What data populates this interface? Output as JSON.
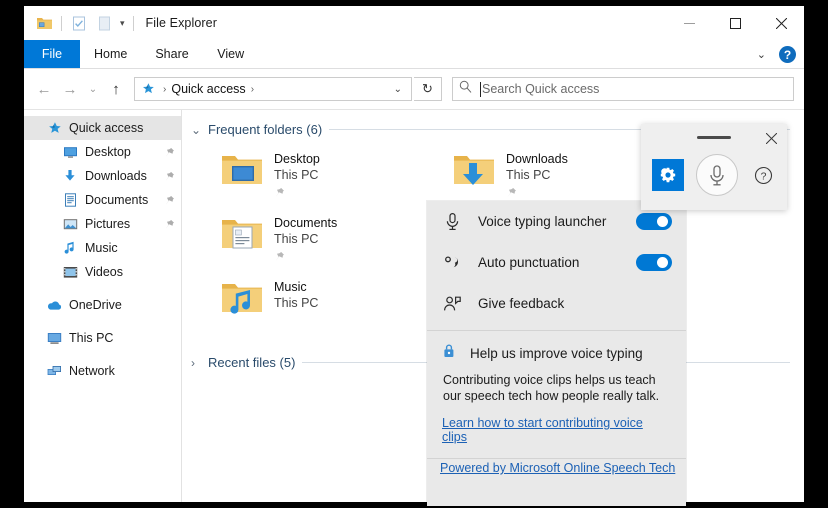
{
  "window": {
    "title": "File Explorer",
    "quick_access_icons": [
      "folder-icon",
      "properties-icon",
      "new-folder-icon"
    ],
    "qat_caret": "customize-quick-access-toolbar",
    "controls": {
      "minimize": "minimize-icon",
      "maximize": "maximize-icon",
      "close": "close-icon"
    }
  },
  "ribbon": {
    "tabs": [
      {
        "label": "File",
        "active": true
      },
      {
        "label": "Home",
        "active": false
      },
      {
        "label": "Share",
        "active": false
      },
      {
        "label": "View",
        "active": false
      }
    ],
    "expand_caret": "chevron-down-icon",
    "help_label": "?"
  },
  "addressbar": {
    "back": "back-arrow-icon",
    "forward": "forward-arrow-icon",
    "recent": "chevron-down-icon",
    "up": "up-arrow-icon",
    "crumb_icon": "pin-star-icon",
    "crumb": "Quick access",
    "crumb_sep": "›",
    "dropdown_caret": "chevron-down-icon",
    "refresh": "refresh-icon"
  },
  "search": {
    "icon": "search-icon",
    "placeholder": "Search Quick access",
    "value": ""
  },
  "sidebar": {
    "items": [
      {
        "label": "Quick access",
        "icon": "pin-star-icon",
        "selected": true,
        "pinned": false,
        "indent": 0
      },
      {
        "label": "Desktop",
        "icon": "desktop-icon",
        "selected": false,
        "pinned": true,
        "indent": 1
      },
      {
        "label": "Downloads",
        "icon": "downloads-icon",
        "selected": false,
        "pinned": true,
        "indent": 1
      },
      {
        "label": "Documents",
        "icon": "documents-icon",
        "selected": false,
        "pinned": true,
        "indent": 1
      },
      {
        "label": "Pictures",
        "icon": "pictures-icon",
        "selected": false,
        "pinned": true,
        "indent": 1
      },
      {
        "label": "Music",
        "icon": "music-icon",
        "selected": false,
        "pinned": false,
        "indent": 1
      },
      {
        "label": "Videos",
        "icon": "videos-icon",
        "selected": false,
        "pinned": false,
        "indent": 1
      }
    ],
    "groups": [
      {
        "label": "OneDrive",
        "icon": "onedrive-icon"
      },
      {
        "label": "This PC",
        "icon": "thispc-icon"
      },
      {
        "label": "Network",
        "icon": "network-icon"
      }
    ]
  },
  "content": {
    "frequent": {
      "header": "Frequent folders (6)",
      "chevron": "chevron-down-icon",
      "items": [
        {
          "name": "Desktop",
          "sub": "This PC",
          "icon": "folder-desktop-icon",
          "pinned": true
        },
        {
          "name": "Downloads",
          "sub": "This PC",
          "icon": "folder-downloads-icon",
          "pinned": true
        },
        {
          "name": "Documents",
          "sub": "This PC",
          "icon": "folder-documents-icon",
          "pinned": true
        },
        {
          "name": "Music",
          "sub": "This PC",
          "icon": "folder-music-icon",
          "pinned": false
        }
      ]
    },
    "recent": {
      "header": "Recent files (5)",
      "chevron": "chevron-right-icon"
    }
  },
  "voice_toolbar": {
    "drag_handle": "drag-handle-icon",
    "close": "close-icon",
    "settings_icon": "gear-icon",
    "mic_icon": "microphone-icon",
    "help_icon": "help-circle-icon"
  },
  "voice_settings": {
    "rows": [
      {
        "label": "Voice typing launcher",
        "icon": "microphone-icon",
        "toggle": true
      },
      {
        "label": "Auto punctuation",
        "icon": "punctuation-icon",
        "toggle": true
      },
      {
        "label": "Give feedback",
        "icon": "feedback-person-icon",
        "toggle": false
      }
    ],
    "help": {
      "icon": "lock-icon",
      "title": "Help us improve voice typing",
      "body": "Contributing voice clips helps us teach our speech tech how people really talk.",
      "link": "Learn how to start contributing voice clips"
    },
    "footer_link": "Powered by Microsoft Online Speech Tech"
  },
  "colors": {
    "accent": "#0078d7",
    "tab_active_bg": "#0078d7",
    "link": "#1c61b5",
    "panel_bg": "#e9e9e9",
    "group_header": "#2a4b6b"
  }
}
